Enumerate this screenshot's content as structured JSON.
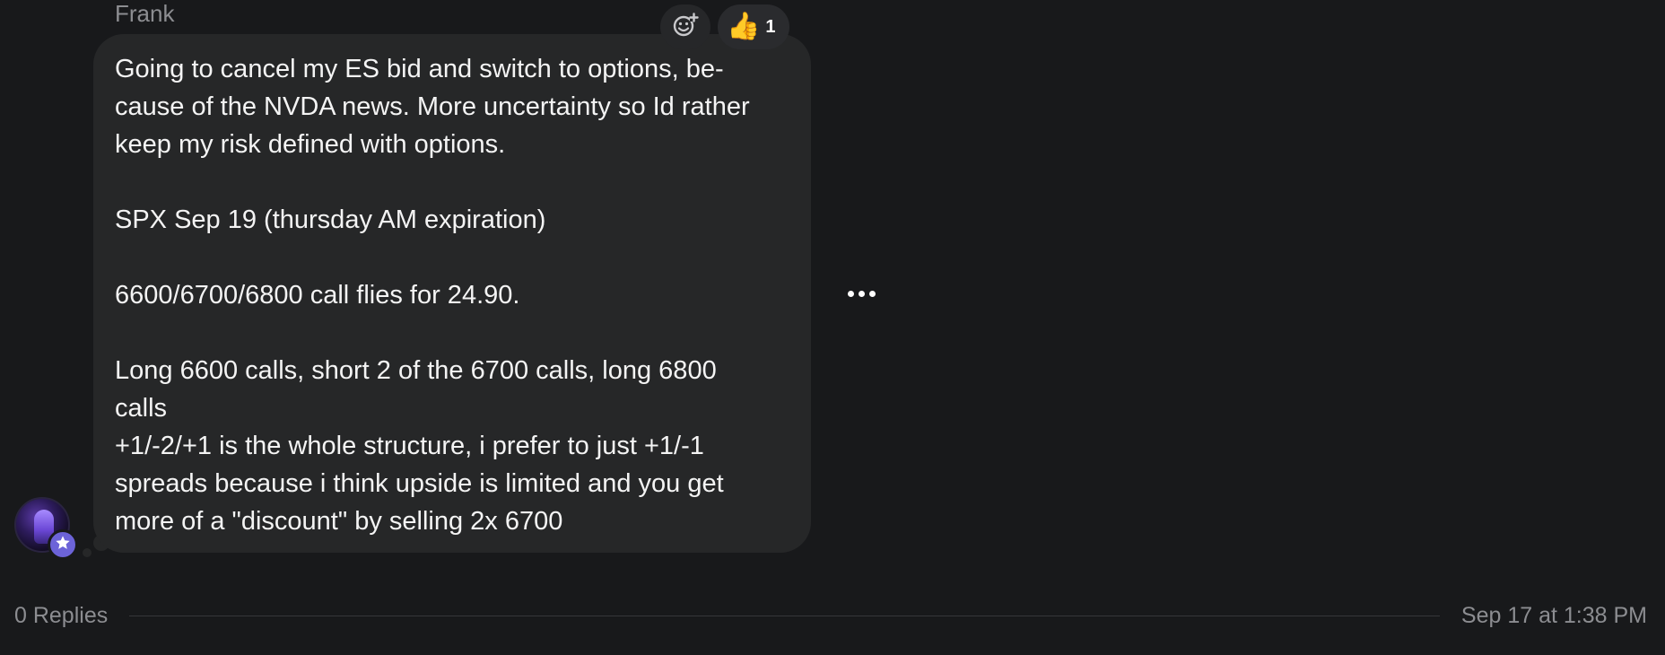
{
  "message": {
    "sender": "Frank",
    "lines": [
      "Going to cancel my ES bid and switch to options, be-",
      "cause of the NVDA news. More uncertainty so Id rather",
      "keep my risk defined with options.",
      "",
      "SPX Sep 19 (thursday AM expiration)",
      "",
      "6600/6700/6800 call flies for 24.90.",
      "",
      "Long 6600 calls, short 2 of the 6700 calls, long 6800",
      "calls",
      "+1/-2/+1 is the whole structure, i prefer to just +1/-1",
      "spreads because i think upside is limited and you get",
      "more of a \"discount\" by selling 2x 6700"
    ]
  },
  "reactions": {
    "add_icon": "add-reaction-icon",
    "items": [
      {
        "emoji": "👍",
        "icon": "thumbs-up-icon",
        "count": "1"
      }
    ]
  },
  "actions": {
    "more_icon": "more-horizontal-icon"
  },
  "avatar": {
    "badge_icon": "star-icon"
  },
  "footer": {
    "replies": "0 Replies",
    "timestamp": "Sep 17 at 1:38 PM"
  },
  "colors": {
    "background": "#18191b",
    "bubble": "#262728",
    "badge": "#6c63d8",
    "muted_text": "#8c8d91"
  }
}
